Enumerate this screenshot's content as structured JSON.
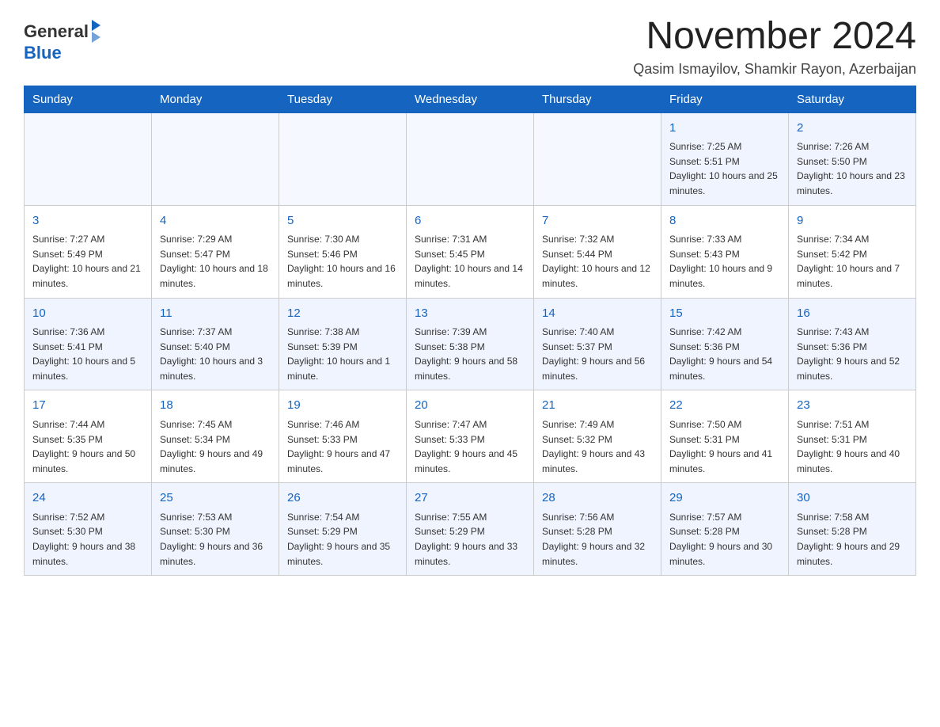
{
  "logo": {
    "general": "General",
    "blue": "Blue"
  },
  "title": "November 2024",
  "subtitle": "Qasim Ismayilov, Shamkir Rayon, Azerbaijan",
  "weekdays": [
    "Sunday",
    "Monday",
    "Tuesday",
    "Wednesday",
    "Thursday",
    "Friday",
    "Saturday"
  ],
  "weeks": [
    [
      {
        "day": "",
        "info": ""
      },
      {
        "day": "",
        "info": ""
      },
      {
        "day": "",
        "info": ""
      },
      {
        "day": "",
        "info": ""
      },
      {
        "day": "",
        "info": ""
      },
      {
        "day": "1",
        "info": "Sunrise: 7:25 AM\nSunset: 5:51 PM\nDaylight: 10 hours and 25 minutes."
      },
      {
        "day": "2",
        "info": "Sunrise: 7:26 AM\nSunset: 5:50 PM\nDaylight: 10 hours and 23 minutes."
      }
    ],
    [
      {
        "day": "3",
        "info": "Sunrise: 7:27 AM\nSunset: 5:49 PM\nDaylight: 10 hours and 21 minutes."
      },
      {
        "day": "4",
        "info": "Sunrise: 7:29 AM\nSunset: 5:47 PM\nDaylight: 10 hours and 18 minutes."
      },
      {
        "day": "5",
        "info": "Sunrise: 7:30 AM\nSunset: 5:46 PM\nDaylight: 10 hours and 16 minutes."
      },
      {
        "day": "6",
        "info": "Sunrise: 7:31 AM\nSunset: 5:45 PM\nDaylight: 10 hours and 14 minutes."
      },
      {
        "day": "7",
        "info": "Sunrise: 7:32 AM\nSunset: 5:44 PM\nDaylight: 10 hours and 12 minutes."
      },
      {
        "day": "8",
        "info": "Sunrise: 7:33 AM\nSunset: 5:43 PM\nDaylight: 10 hours and 9 minutes."
      },
      {
        "day": "9",
        "info": "Sunrise: 7:34 AM\nSunset: 5:42 PM\nDaylight: 10 hours and 7 minutes."
      }
    ],
    [
      {
        "day": "10",
        "info": "Sunrise: 7:36 AM\nSunset: 5:41 PM\nDaylight: 10 hours and 5 minutes."
      },
      {
        "day": "11",
        "info": "Sunrise: 7:37 AM\nSunset: 5:40 PM\nDaylight: 10 hours and 3 minutes."
      },
      {
        "day": "12",
        "info": "Sunrise: 7:38 AM\nSunset: 5:39 PM\nDaylight: 10 hours and 1 minute."
      },
      {
        "day": "13",
        "info": "Sunrise: 7:39 AM\nSunset: 5:38 PM\nDaylight: 9 hours and 58 minutes."
      },
      {
        "day": "14",
        "info": "Sunrise: 7:40 AM\nSunset: 5:37 PM\nDaylight: 9 hours and 56 minutes."
      },
      {
        "day": "15",
        "info": "Sunrise: 7:42 AM\nSunset: 5:36 PM\nDaylight: 9 hours and 54 minutes."
      },
      {
        "day": "16",
        "info": "Sunrise: 7:43 AM\nSunset: 5:36 PM\nDaylight: 9 hours and 52 minutes."
      }
    ],
    [
      {
        "day": "17",
        "info": "Sunrise: 7:44 AM\nSunset: 5:35 PM\nDaylight: 9 hours and 50 minutes."
      },
      {
        "day": "18",
        "info": "Sunrise: 7:45 AM\nSunset: 5:34 PM\nDaylight: 9 hours and 49 minutes."
      },
      {
        "day": "19",
        "info": "Sunrise: 7:46 AM\nSunset: 5:33 PM\nDaylight: 9 hours and 47 minutes."
      },
      {
        "day": "20",
        "info": "Sunrise: 7:47 AM\nSunset: 5:33 PM\nDaylight: 9 hours and 45 minutes."
      },
      {
        "day": "21",
        "info": "Sunrise: 7:49 AM\nSunset: 5:32 PM\nDaylight: 9 hours and 43 minutes."
      },
      {
        "day": "22",
        "info": "Sunrise: 7:50 AM\nSunset: 5:31 PM\nDaylight: 9 hours and 41 minutes."
      },
      {
        "day": "23",
        "info": "Sunrise: 7:51 AM\nSunset: 5:31 PM\nDaylight: 9 hours and 40 minutes."
      }
    ],
    [
      {
        "day": "24",
        "info": "Sunrise: 7:52 AM\nSunset: 5:30 PM\nDaylight: 9 hours and 38 minutes."
      },
      {
        "day": "25",
        "info": "Sunrise: 7:53 AM\nSunset: 5:30 PM\nDaylight: 9 hours and 36 minutes."
      },
      {
        "day": "26",
        "info": "Sunrise: 7:54 AM\nSunset: 5:29 PM\nDaylight: 9 hours and 35 minutes."
      },
      {
        "day": "27",
        "info": "Sunrise: 7:55 AM\nSunset: 5:29 PM\nDaylight: 9 hours and 33 minutes."
      },
      {
        "day": "28",
        "info": "Sunrise: 7:56 AM\nSunset: 5:28 PM\nDaylight: 9 hours and 32 minutes."
      },
      {
        "day": "29",
        "info": "Sunrise: 7:57 AM\nSunset: 5:28 PM\nDaylight: 9 hours and 30 minutes."
      },
      {
        "day": "30",
        "info": "Sunrise: 7:58 AM\nSunset: 5:28 PM\nDaylight: 9 hours and 29 minutes."
      }
    ]
  ]
}
